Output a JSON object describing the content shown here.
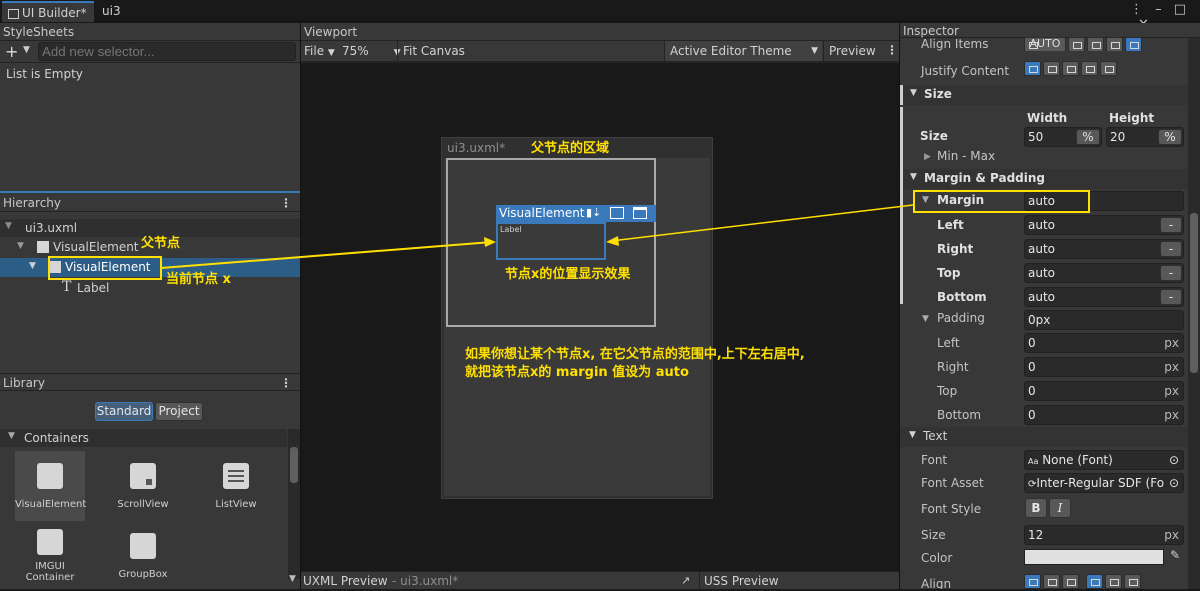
{
  "tabs": {
    "ui_builder": "UI Builder*",
    "ui3": "ui3"
  },
  "stylesheets": {
    "title": "StyleSheets",
    "add_selector_placeholder": "Add new selector...",
    "empty_text": "List is Empty"
  },
  "viewport": {
    "title": "Viewport",
    "file_menu": "File",
    "zoom": "75%",
    "fit_canvas": "Fit Canvas",
    "theme": "Active Editor Theme",
    "preview": "Preview",
    "document_label": "ui3.uxml*"
  },
  "canvas": {
    "selected_element": "VisualElement",
    "inner_label": "Label"
  },
  "hierarchy": {
    "title": "Hierarchy",
    "root": "ui3.uxml",
    "items": [
      "VisualElement",
      "VisualElement",
      "Label"
    ]
  },
  "library": {
    "title": "Library",
    "tab_standard": "Standard",
    "tab_project": "Project",
    "section": "Containers",
    "items": [
      "VisualElement",
      "ScrollView",
      "ListView",
      "IMGUI Container",
      "GroupBox"
    ]
  },
  "bottom": {
    "uxml_preview": "UXML Preview",
    "uxml_file": "- ui3.uxml*",
    "uss_preview": "USS Preview"
  },
  "inspector": {
    "title": "Inspector",
    "align_items": "Align Items",
    "align_items_value": "AUTO",
    "justify_content": "Justify Content",
    "size_section": "Size",
    "size_label": "Size",
    "width_label": "Width",
    "height_label": "Height",
    "width_value": "50",
    "height_value": "20",
    "unit_percent": "%",
    "min_max": "Min - Max",
    "margin_padding_section": "Margin & Padding",
    "margin_label": "Margin",
    "margin_value": "auto",
    "margin_rows": [
      {
        "label": "Left",
        "value": "auto",
        "unit": "-"
      },
      {
        "label": "Right",
        "value": "auto",
        "unit": "-"
      },
      {
        "label": "Top",
        "value": "auto",
        "unit": "-"
      },
      {
        "label": "Bottom",
        "value": "auto",
        "unit": "-"
      }
    ],
    "padding_label": "Padding",
    "padding_value": "0px",
    "padding_rows": [
      {
        "label": "Left",
        "value": "0",
        "unit": "px"
      },
      {
        "label": "Right",
        "value": "0",
        "unit": "px"
      },
      {
        "label": "Top",
        "value": "0",
        "unit": "px"
      },
      {
        "label": "Bottom",
        "value": "0",
        "unit": "px"
      }
    ],
    "text_section": "Text",
    "font_label": "Font",
    "font_value": "None (Font)",
    "font_asset_label": "Font Asset",
    "font_asset_value": "Inter-Regular SDF (Fo",
    "font_style_label": "Font Style",
    "bold_btn": "B",
    "italic_btn": "I",
    "size_text_label": "Size",
    "size_text_value": "12",
    "size_text_unit": "px",
    "color_label": "Color",
    "align_label": "Align"
  },
  "annotations": {
    "parent_area": "父节点的区域",
    "parent_node": "父节点",
    "current_node": "当前节点 x",
    "display_effect": "节点x的位置显示效果",
    "explain_line1": "如果你想让某个节点x, 在它父节点的范围中,上下左右居中,",
    "explain_line2": "就把该节点x的 margin 值设为 auto"
  },
  "colors": {
    "accent": "#3a79bb",
    "annotation": "#ffe000",
    "panel": "#383838",
    "viewport_bg": "#191919"
  }
}
